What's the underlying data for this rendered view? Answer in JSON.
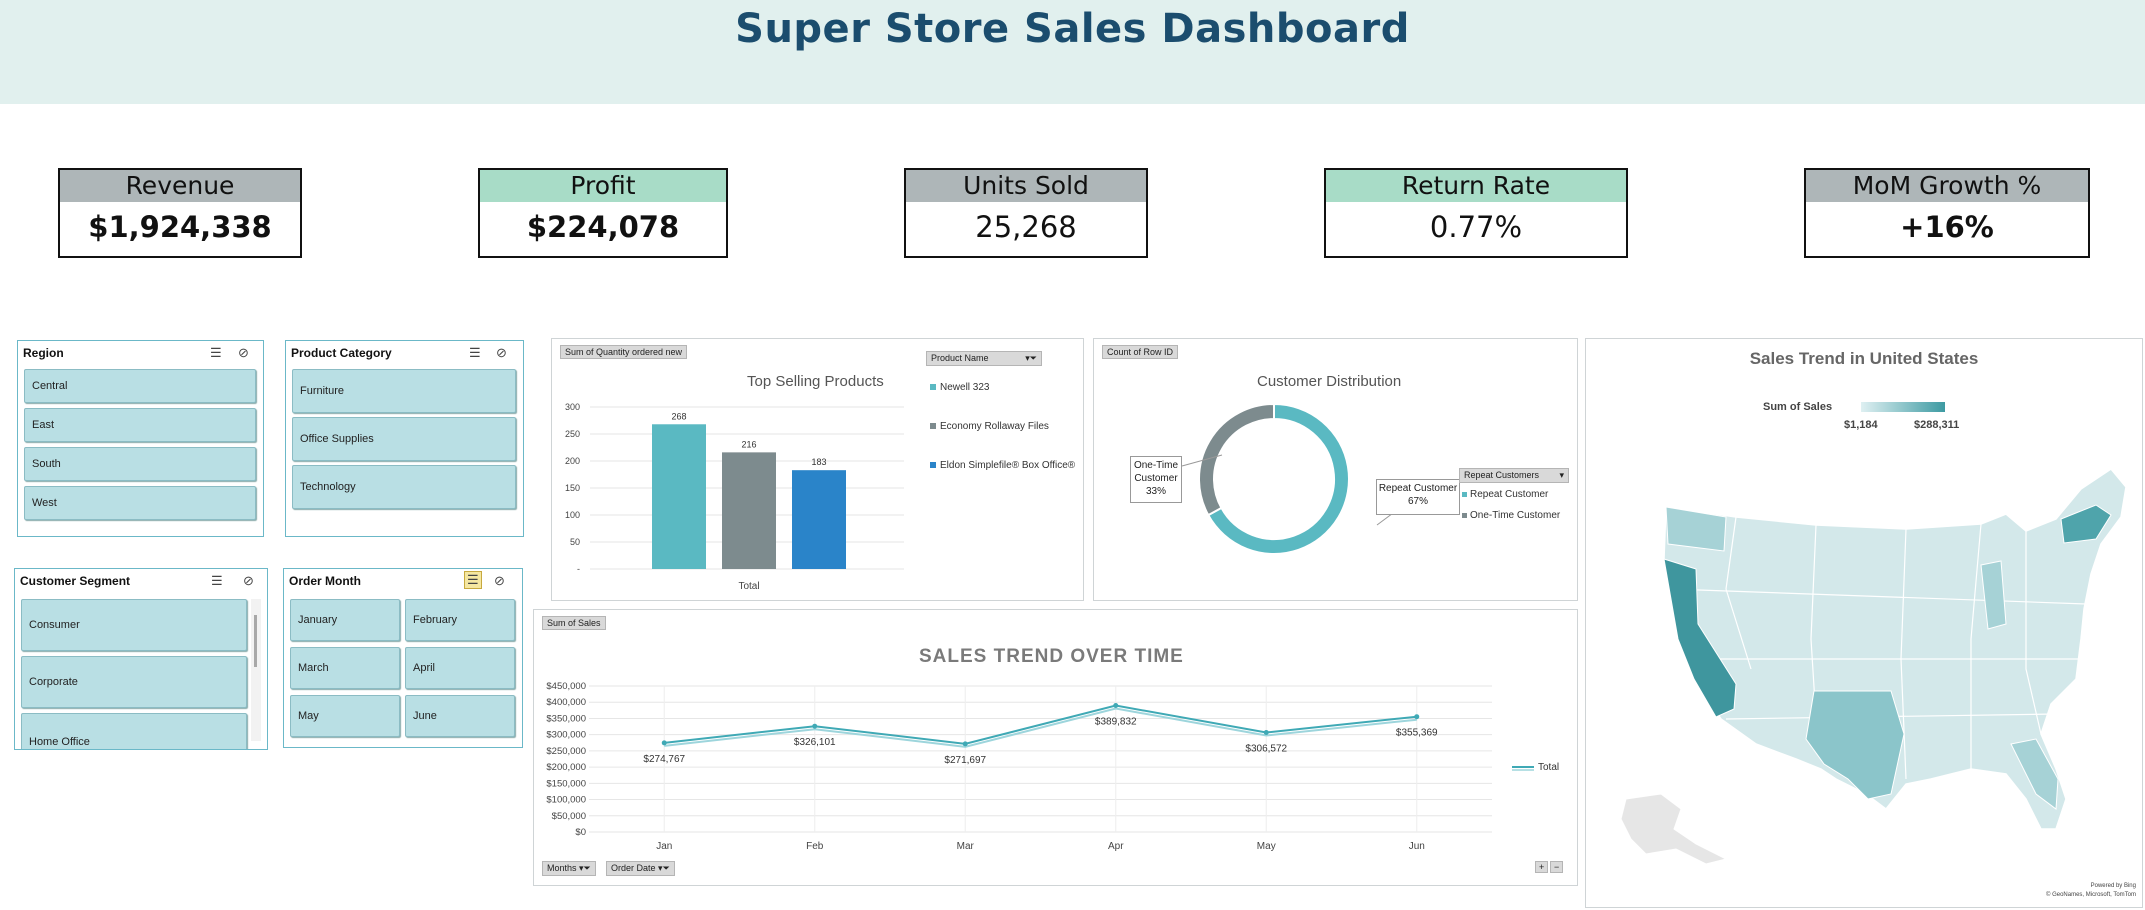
{
  "title": "Super Store Sales Dashboard",
  "kpis": [
    {
      "label": "Revenue",
      "value": "$1,924,338"
    },
    {
      "label": "Profit",
      "value": "$224,078"
    },
    {
      "label": "Units Sold",
      "value": "25,268"
    },
    {
      "label": "Return Rate",
      "value": "0.77%"
    },
    {
      "label": "MoM Growth %",
      "value": "+16%"
    }
  ],
  "slicers": {
    "region": {
      "title": "Region",
      "items": [
        "Central",
        "East",
        "South",
        "West"
      ]
    },
    "category": {
      "title": "Product Category",
      "items": [
        "Furniture",
        "Office Supplies",
        "Technology"
      ]
    },
    "segment": {
      "title": "Customer Segment",
      "items": [
        "Consumer",
        "Corporate",
        "Home Office"
      ]
    },
    "month": {
      "title": "Order Month",
      "items": [
        "January",
        "February",
        "March",
        "April",
        "May",
        "June"
      ]
    }
  },
  "top_products": {
    "field_button": "Sum of Quantity ordered new",
    "legend_header": "Product Name",
    "x_label": "Total"
  },
  "customer_dist": {
    "field_button": "Count of Row ID",
    "legend_header": "Repeat Customers",
    "labels": {
      "one_time_line1": "One-Time",
      "one_time_line2": "Customer",
      "one_time_pct": "33%",
      "repeat_line1": "Repeat Customer",
      "repeat_pct": "67%"
    }
  },
  "sales_trend": {
    "field_button": "Sum of Sales",
    "legend": "Total",
    "filter_months": "Months",
    "filter_order_date": "Order Date",
    "zoom_in": "+",
    "zoom_out": "−"
  },
  "map": {
    "title": "Sales Trend in United States",
    "legend_title": "Sum of Sales",
    "legend_min": "$1,184",
    "legend_max": "$288,311",
    "credit1": "Powered by Bing",
    "credit2": "© GeoNames, Microsoft, TomTom",
    "colors": {
      "low": "#dff0f2",
      "high": "#3d9aa2"
    }
  },
  "chart_data": [
    {
      "type": "bar",
      "title": "Top Selling Products",
      "categories": [
        "Total"
      ],
      "series": [
        {
          "name": "Newell 323",
          "values": [
            268
          ],
          "color": "#5ab9c2"
        },
        {
          "name": "Economy Rollaway Files",
          "values": [
            216
          ],
          "color": "#7d8b8e"
        },
        {
          "name": "Eldon Simplefile® Box Office®",
          "values": [
            183
          ],
          "color": "#2a84c9"
        }
      ],
      "yticks": [
        "300",
        "250",
        "200",
        "150",
        "100",
        "50",
        "-"
      ],
      "ylim": [
        0,
        300
      ]
    },
    {
      "type": "pie",
      "title": "Customer Distribution",
      "series": [
        {
          "name": "Repeat Customer",
          "value": 67,
          "color": "#5ab9c2"
        },
        {
          "name": "One-Time Customer",
          "value": 33,
          "color": "#7d8b8e"
        }
      ]
    },
    {
      "type": "line",
      "title": "SALES TREND OVER TIME",
      "x": [
        "Jan",
        "Feb",
        "Mar",
        "Apr",
        "May",
        "Jun"
      ],
      "series": [
        {
          "name": "Total",
          "values": [
            274767,
            326101,
            271697,
            389832,
            306572,
            355369
          ],
          "labels": [
            "$274,767",
            "$326,101",
            "$271,697",
            "$389,832",
            "$306,572",
            "$355,369"
          ]
        }
      ],
      "yticks": [
        "$450,000",
        "$400,000",
        "$350,000",
        "$300,000",
        "$250,000",
        "$200,000",
        "$150,000",
        "$100,000",
        "$50,000",
        "$0"
      ],
      "ylim": [
        0,
        450000
      ]
    }
  ]
}
